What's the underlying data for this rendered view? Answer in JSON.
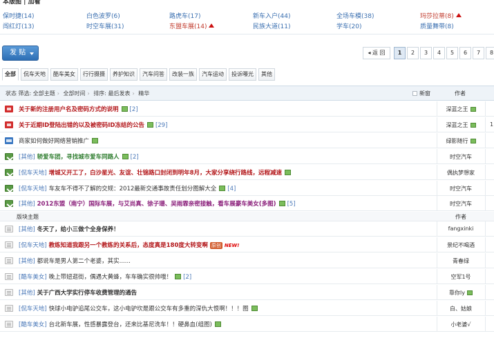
{
  "board_panel": {
    "title": "本版图 | 加看",
    "links": [
      {
        "label": "保时捷(14)",
        "hot": false,
        "arrow": false
      },
      {
        "label": "白色波罗(6)",
        "hot": false,
        "arrow": false
      },
      {
        "label": "路虎车(17)",
        "hot": false,
        "arrow": false
      },
      {
        "label": "新车入户(44)",
        "hot": false,
        "arrow": false
      },
      {
        "label": "全场车模(38)",
        "hot": false,
        "arrow": false
      },
      {
        "label": "玛莎拉蒂(8)",
        "hot": true,
        "arrow": true
      },
      {
        "label": "闯红灯(13)",
        "hot": false,
        "arrow": false
      },
      {
        "label": "时空车展(31)",
        "hot": false,
        "arrow": false
      },
      {
        "label": "东盟车展(14)",
        "hot": true,
        "arrow": true
      },
      {
        "label": "民族大道(11)",
        "hot": false,
        "arrow": false
      },
      {
        "label": "学车(20)",
        "hot": false,
        "arrow": false
      },
      {
        "label": "质量舞带(8)",
        "hot": false,
        "arrow": false
      }
    ]
  },
  "toolbar": {
    "post_label": "发 贴"
  },
  "pager": {
    "prev_label": "◂ 返 回",
    "pages": [
      "1",
      "2",
      "3",
      "4",
      "5",
      "6",
      "7",
      "8"
    ],
    "current": "1"
  },
  "tabs": [
    "全部",
    "侃车天地",
    "酷车美女",
    "行行摄摄",
    "养护知识",
    "汽车问答",
    "改装一族",
    "汽车运动",
    "投诉曝光",
    "其他"
  ],
  "list_header": {
    "filter_label": "状态 筛选:",
    "filter_all_topics": "全部主题",
    "filter_all_time": "全部时间",
    "sort_label": "排序: 最后发表",
    "best_label": "精华",
    "new_label": "新窗",
    "author_label": "作者"
  },
  "rows": [
    {
      "kind": "topic",
      "icon": "announce",
      "tag": "",
      "title": "关于新的注册用户名及密码方式的说明",
      "color": "red",
      "bold": true,
      "img": true,
      "reply": "[2]",
      "award": "",
      "new": false,
      "author": "深蓝之王",
      "author_img": true,
      "extra": ""
    },
    {
      "kind": "topic",
      "icon": "announce",
      "tag": "",
      "title": "关于近期ID登陆出错的以及被密码ID冻结的公告",
      "color": "red",
      "bold": true,
      "img": true,
      "reply": "[29]",
      "award": "",
      "new": false,
      "author": "深蓝之王",
      "author_img": true,
      "extra": "1"
    },
    {
      "kind": "topic",
      "icon": "ad",
      "tag": "",
      "title": "商家如何做好网络营销推广",
      "color": "",
      "bold": false,
      "img": true,
      "reply": "",
      "award": "",
      "new": false,
      "author": "绿影随行",
      "author_img": true,
      "extra": ""
    },
    {
      "kind": "topic",
      "icon": "pin",
      "tag": "[其他]",
      "title": "轿爱车团，寻找城市爱车同路人",
      "color": "green",
      "bold": true,
      "img": true,
      "reply": "[2]",
      "award": "",
      "new": false,
      "author": "时空汽车",
      "author_img": false,
      "extra": ""
    },
    {
      "kind": "topic",
      "icon": "pin",
      "tag": "[侃车天地]",
      "title": "增城又开工了，白沙星光、友谊、壮锦路口封闭到明年8月，大家分享绕行路线，远程减速",
      "color": "red",
      "bold": true,
      "img": true,
      "reply": "",
      "award": "",
      "new": false,
      "author": "偶执梦想家",
      "author_img": false,
      "extra": ""
    },
    {
      "kind": "topic",
      "icon": "pin",
      "tag": "[侃车天地]",
      "title": "车友车不得不了解的交规：2012最新交通事故责任划分图解大全",
      "color": "",
      "bold": false,
      "img": true,
      "reply": "[4]",
      "award": "",
      "new": false,
      "author": "时空汽车",
      "author_img": false,
      "extra": ""
    },
    {
      "kind": "topic",
      "icon": "pin",
      "tag": "[其他]",
      "title": "2012东盟（南宁）国际车展，与艾尚真、徐子珊、吴雨霏亲密接触，看车展豪车美女(多图)",
      "color": "purple",
      "bold": true,
      "img": true,
      "reply": "[5]",
      "award": "",
      "new": false,
      "author": "时空汽车",
      "author_img": false,
      "extra": ""
    },
    {
      "kind": "section",
      "label": "版块主题",
      "author_label": "作者"
    },
    {
      "kind": "topic",
      "icon": "normal",
      "tag": "[其他]",
      "title": "冬天了，给小三做个全身保养！",
      "color": "",
      "bold": true,
      "img": false,
      "reply": "",
      "award": "",
      "new": false,
      "author": "fangxinki",
      "author_img": false,
      "extra": ""
    },
    {
      "kind": "topic",
      "icon": "normal",
      "tag": "[侃车天地]",
      "title": "教练知道我跟另一个教练的关系后，态度真是180度大转变啊",
      "color": "red",
      "bold": true,
      "img": false,
      "reply": "",
      "award": "原创",
      "new": true,
      "author": "景纪不喝酒",
      "author_img": false,
      "extra": ""
    },
    {
      "kind": "topic",
      "icon": "normal",
      "tag": "[其他]",
      "title": "都说车是男人第二个老婆，其实......",
      "color": "",
      "bold": false,
      "img": false,
      "reply": "",
      "award": "",
      "new": false,
      "author": "青春绿",
      "author_img": false,
      "extra": ""
    },
    {
      "kind": "topic",
      "icon": "normal",
      "tag": "[酷车美女]",
      "title": "晚上带妞逛街，偶遇大黄蜂，车车确实很帅哦！",
      "color": "",
      "bold": false,
      "img": true,
      "reply": "[2]",
      "award": "",
      "new": false,
      "author": "空军1号",
      "author_img": false,
      "extra": ""
    },
    {
      "kind": "topic",
      "icon": "normal",
      "tag": "[其他]",
      "title": "关于广西大学实行停车收费管理的通告",
      "color": "",
      "bold": true,
      "img": false,
      "reply": "",
      "award": "",
      "new": false,
      "author": "靠你ly",
      "author_img": true,
      "extra": ""
    },
    {
      "kind": "topic",
      "icon": "normal",
      "tag": "[侃车天地]",
      "title": "快球小电驴追尾公交车，这小电驴坎是跟公交车有多重的深仇大恨啊！！！图",
      "color": "",
      "bold": false,
      "img": true,
      "reply": "",
      "award": "",
      "new": false,
      "author": "白、姑娘",
      "author_img": false,
      "extra": ""
    },
    {
      "kind": "topic",
      "icon": "normal",
      "tag": "[酷车美女]",
      "title": "台北新车展，性感暴露登台，还来比基尼洗车！！硬鼻血(组图)",
      "color": "",
      "bold": false,
      "img": true,
      "reply": "",
      "award": "",
      "new": false,
      "author": "小老婆√",
      "author_img": false,
      "extra": ""
    }
  ]
}
